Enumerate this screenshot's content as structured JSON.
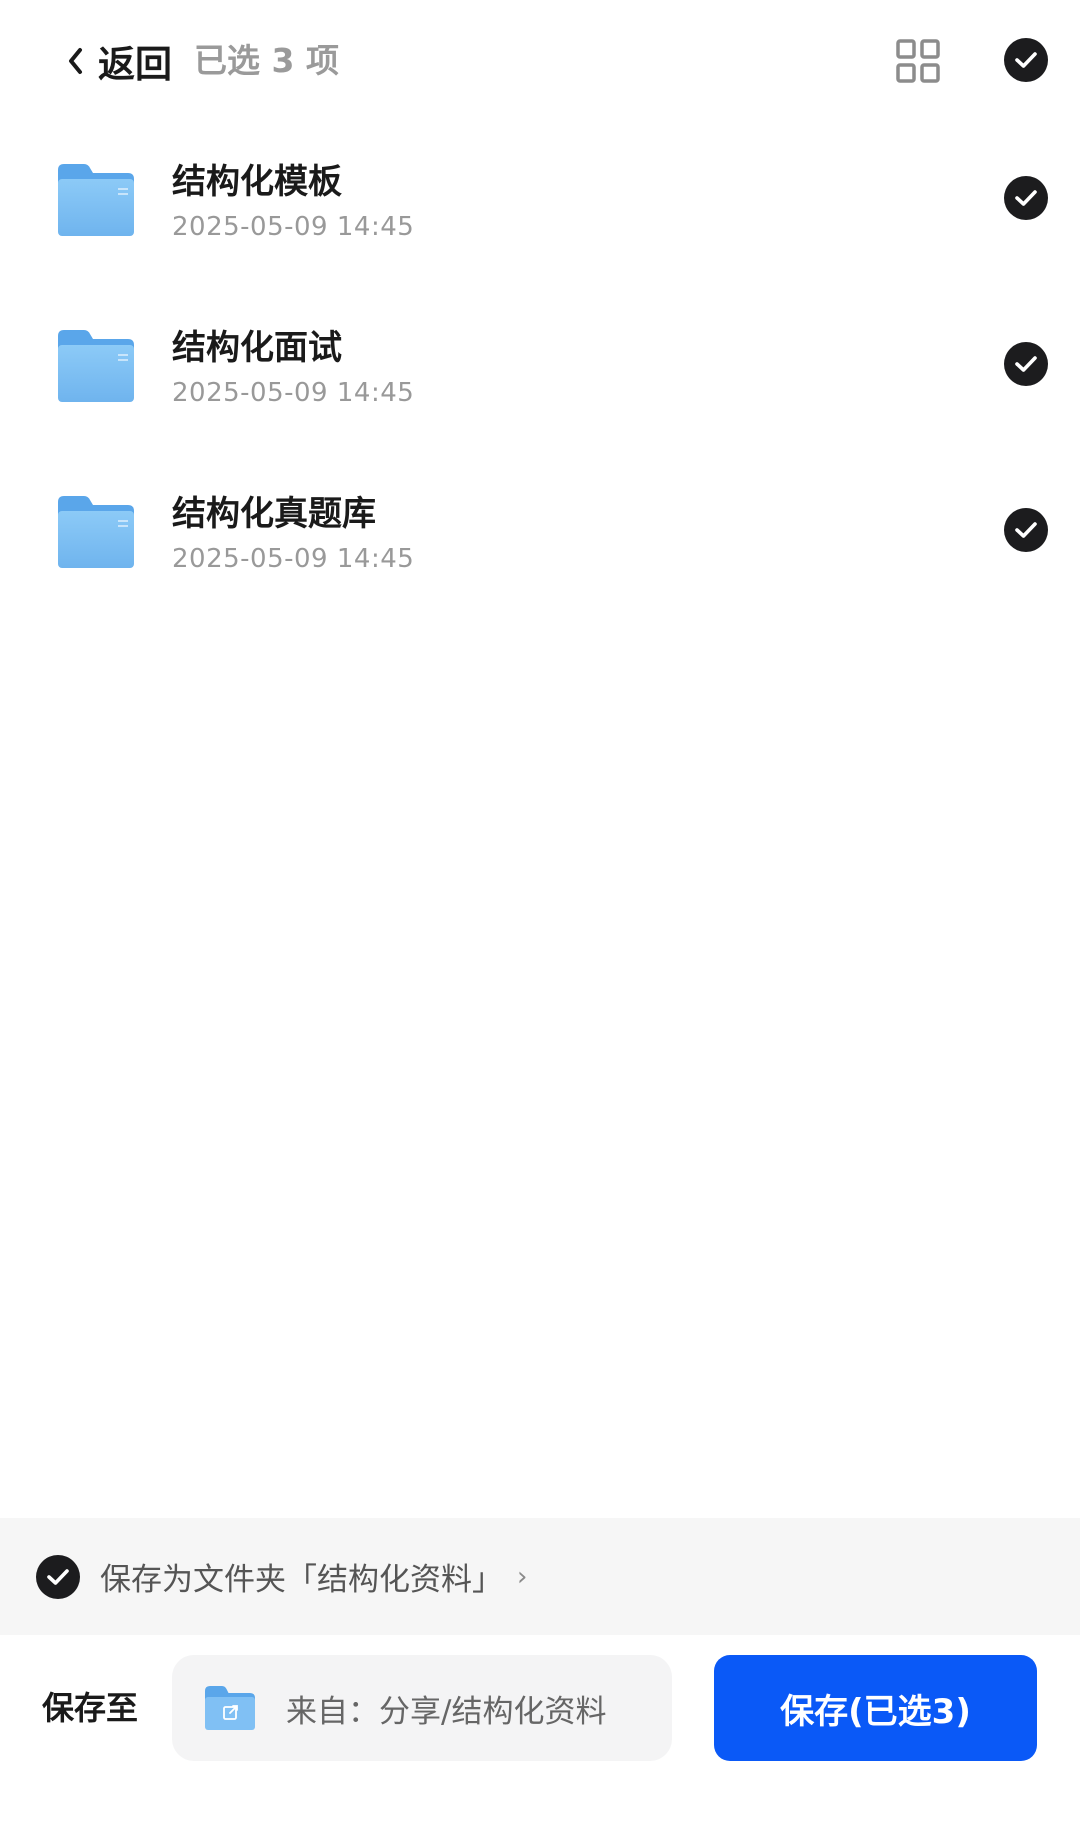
{
  "header": {
    "back_label": "返回",
    "selected_count": "已选 3 项",
    "grid_icon": "grid-view-icon",
    "select_all_icon": "check-circle-icon"
  },
  "files": [
    {
      "name": "结构化模板",
      "date": "2025-05-09 14:45",
      "selected": true,
      "icon": "folder-icon"
    },
    {
      "name": "结构化面试",
      "date": "2025-05-09 14:45",
      "selected": true,
      "icon": "folder-icon"
    },
    {
      "name": "结构化真题库",
      "date": "2025-05-09 14:45",
      "selected": true,
      "icon": "folder-icon"
    }
  ],
  "save_as": {
    "label": "保存为文件夹「结构化资料」",
    "chevron": "›",
    "checked": true
  },
  "bottom": {
    "save_to_label": "保存至",
    "destination": "来自：分享/结构化资料",
    "save_button": "保存(已选3)"
  },
  "colors": {
    "primary": "#0a59f7",
    "check_fill": "#1c1c1e",
    "folder_blue": "#7cbdf2",
    "muted_text": "#999999"
  }
}
